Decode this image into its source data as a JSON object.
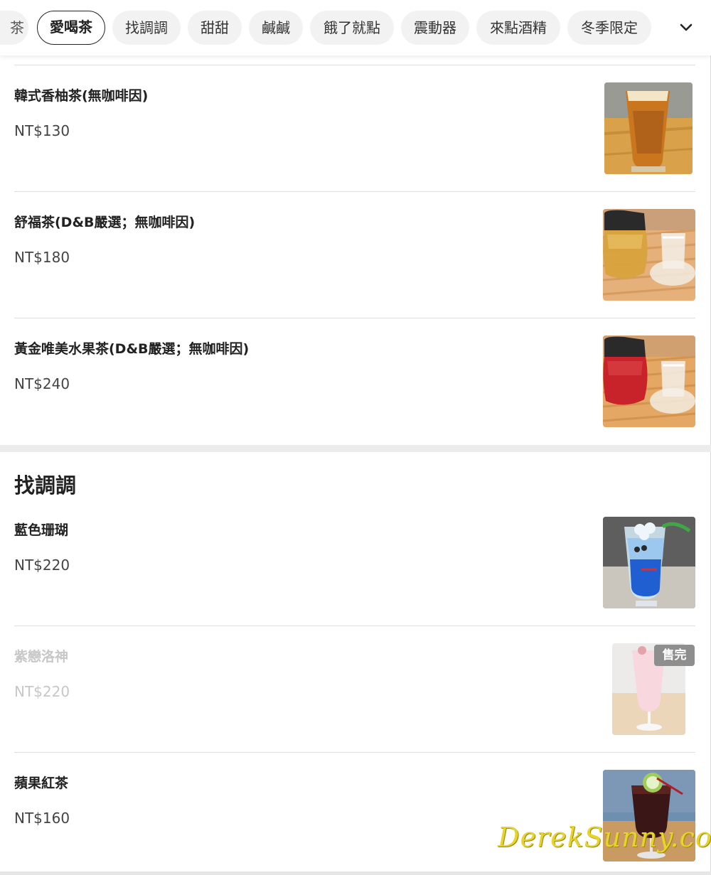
{
  "nav": {
    "categories": [
      "茶",
      "愛喝茶",
      "找調調",
      "甜甜",
      "鹹鹹",
      "餓了就點",
      "震動器",
      "來點酒精",
      "冬季限定"
    ],
    "active_index": 1,
    "more_icon": "chevron-down-icon"
  },
  "items_top": [
    {
      "name": "韓式香柚茶(無咖啡因)",
      "price": "NT$130"
    },
    {
      "name": "舒福茶(D&B嚴選；無咖啡因)",
      "price": "NT$180"
    },
    {
      "name": "黃金唯美水果茶(D&B嚴選；無咖啡因)",
      "price": "NT$240"
    }
  ],
  "section": {
    "title": "找調調"
  },
  "items_bottom": [
    {
      "name": "藍色珊瑚",
      "price": "NT$220"
    },
    {
      "name": "紫戀洛神",
      "price": "NT$220",
      "badge": "售完"
    },
    {
      "name": "蘋果紅茶",
      "price": "NT$160"
    }
  ],
  "watermark": "DerekSunny.com",
  "colors": {
    "chip_bg": "#f2f2f2",
    "soldout_text": "#c7c7c7",
    "badge_bg": "#8e8e8e",
    "watermark": "#e6d42a"
  }
}
